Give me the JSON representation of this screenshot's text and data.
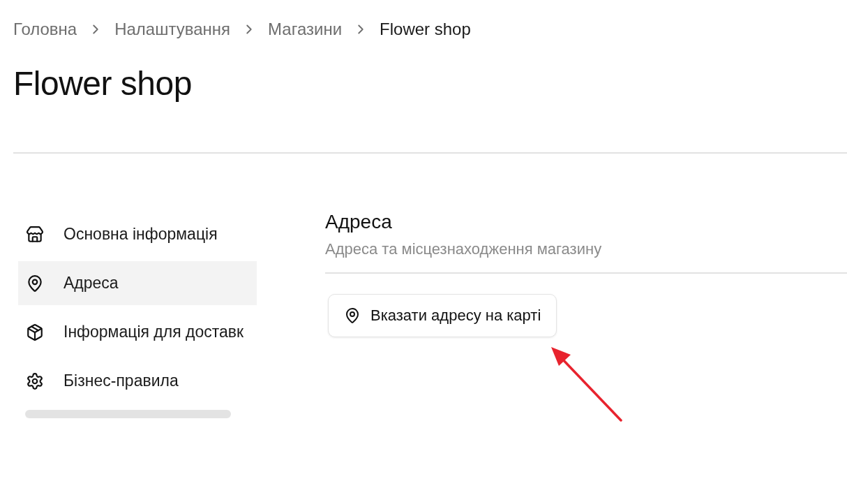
{
  "breadcrumbs": [
    {
      "label": "Головна",
      "current": false
    },
    {
      "label": "Налаштування",
      "current": false
    },
    {
      "label": "Магазини",
      "current": false
    },
    {
      "label": "Flower shop",
      "current": true
    }
  ],
  "title": "Flower shop",
  "sidebar": {
    "items": [
      {
        "label": "Основна інформація",
        "selected": false
      },
      {
        "label": "Адреса",
        "selected": true
      },
      {
        "label": "Інформація для доставк",
        "selected": false
      },
      {
        "label": "Бізнес-правила",
        "selected": false
      }
    ]
  },
  "section": {
    "title": "Адреса",
    "subtitle": "Адреса та місцезнаходження магазину",
    "button": {
      "label": "Вказати адресу на карті"
    }
  }
}
